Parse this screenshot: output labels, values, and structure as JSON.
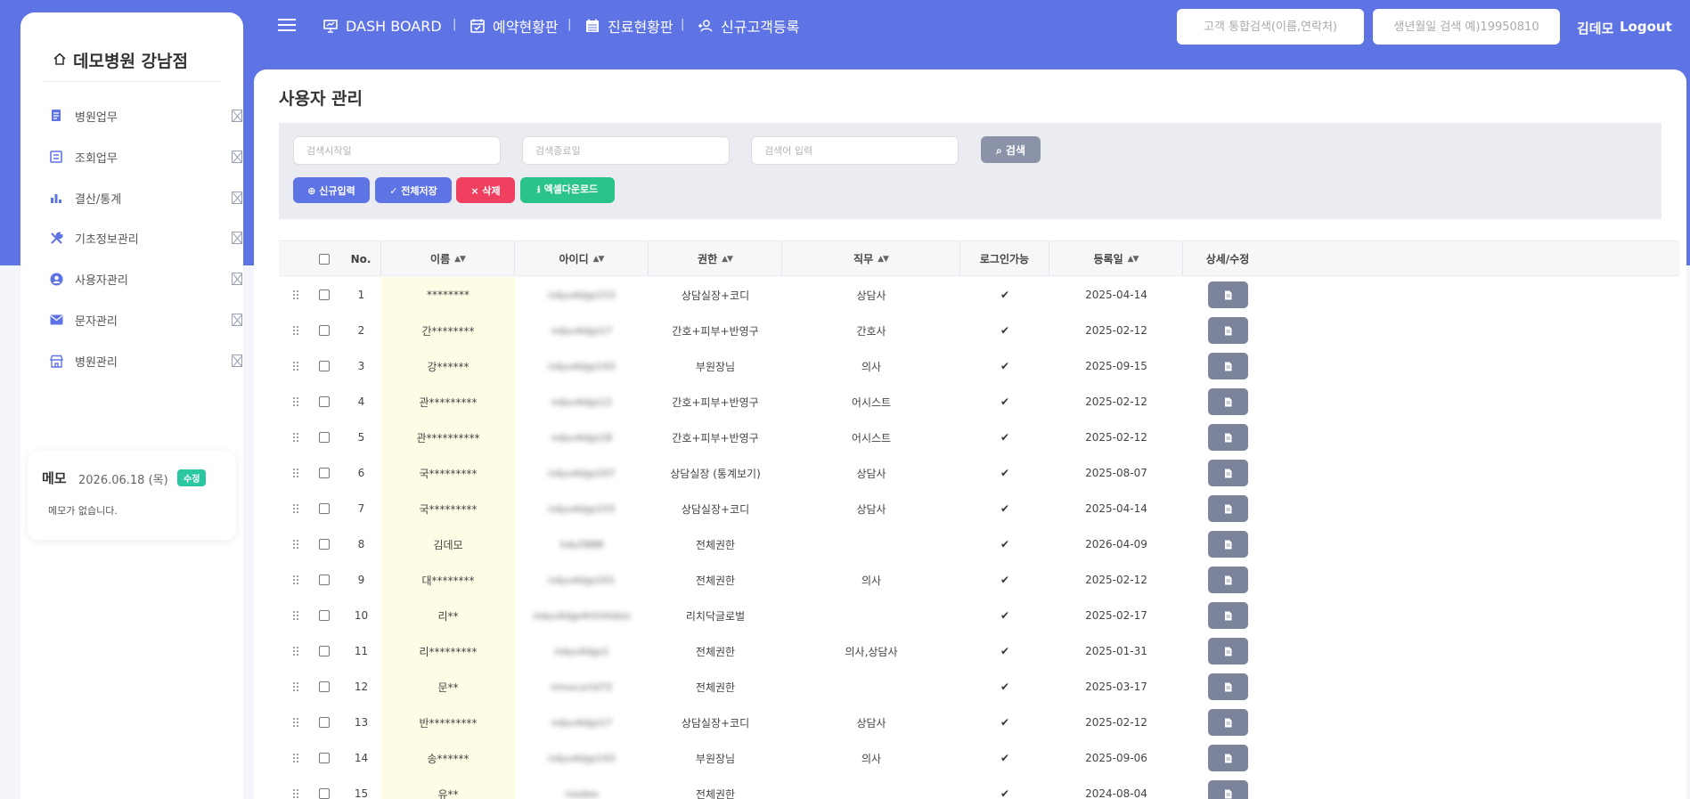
{
  "sidebar": {
    "brand": "데모병원 강남점",
    "items": [
      {
        "label": "병원업무",
        "icon": "document-icon"
      },
      {
        "label": "조회업무",
        "icon": "list-icon"
      },
      {
        "label": "결산/통계",
        "icon": "bar-chart-icon"
      },
      {
        "label": "기초정보관리",
        "icon": "tools-icon"
      },
      {
        "label": "사용자관리",
        "icon": "user-circle-icon"
      },
      {
        "label": "문자관리",
        "icon": "envelope-icon"
      },
      {
        "label": "병원관리",
        "icon": "store-icon"
      }
    ],
    "memo": {
      "title": "메모",
      "date": "2026.06.18 (목)",
      "edit_label": "수정",
      "body": "메모가 없습니다."
    }
  },
  "header": {
    "nav": [
      {
        "label": "DASH BOARD",
        "icon": "presentation-icon"
      },
      {
        "label": "예약현황판",
        "icon": "calendar-check-icon"
      },
      {
        "label": "진료현황판",
        "icon": "calendar-icon"
      },
      {
        "label": "신규고객등록",
        "icon": "user-plus-icon"
      }
    ],
    "search_customer_placeholder": "고객 통합검색(이름,연락처)",
    "search_birth_placeholder": "생년월일 검색 예)19950810",
    "user_name": "김데모",
    "logout_label": "Logout"
  },
  "main": {
    "title": "사용자 관리",
    "filters": {
      "start_placeholder": "검색시작일",
      "end_placeholder": "검색종료일",
      "keyword_placeholder": "검색어 입력",
      "search_label": "검색"
    },
    "actions": {
      "new_label": "신규입력",
      "save_all_label": "전체저장",
      "delete_label": "삭제",
      "excel_label": "엑셀다운로드"
    },
    "colors": {
      "header_bg": "#5f74e4",
      "new_btn": "#5f74e4",
      "delete_btn": "#f0405f",
      "excel_btn": "#2ac48a",
      "name_col_bg": "#fffce6"
    },
    "table": {
      "headers": {
        "no": "No.",
        "name": "이름",
        "id": "아이디",
        "role": "권한",
        "job": "직무",
        "login": "로그인가능",
        "reg_date": "등록일",
        "detail": "상세/수정"
      },
      "rows": [
        {
          "no": "1",
          "name": "********",
          "id": "ndyu4dgs153",
          "role": "상담실장+코디",
          "job": "상담사",
          "login": "✔",
          "date": "2025-04-14"
        },
        {
          "no": "2",
          "name": "간********",
          "id": "ndyu4dgs17",
          "role": "간호+피부+반영구",
          "job": "간호사",
          "login": "✔",
          "date": "2025-02-12"
        },
        {
          "no": "3",
          "name": "강******",
          "id": "ndyu4dgs143",
          "role": "부원장님",
          "job": "의사",
          "login": "✔",
          "date": "2025-09-15"
        },
        {
          "no": "4",
          "name": "관*********",
          "id": "ndyu4dgs12",
          "role": "간호+피부+반영구",
          "job": "어시스트",
          "login": "✔",
          "date": "2025-02-12"
        },
        {
          "no": "5",
          "name": "관**********",
          "id": "ndyu4dgs18",
          "role": "간호+피부+반영구",
          "job": "어시스트",
          "login": "✔",
          "date": "2025-02-12"
        },
        {
          "no": "6",
          "name": "국*********",
          "id": "ndyu4dgs107",
          "role": "상담실장 (통계보기)",
          "job": "상담사",
          "login": "✔",
          "date": "2025-08-07"
        },
        {
          "no": "7",
          "name": "국*********",
          "id": "ndyu4dgs155",
          "role": "상담실장+코디",
          "job": "상담사",
          "login": "✔",
          "date": "2025-04-14"
        },
        {
          "no": "8",
          "name": "김데모",
          "id": "hdu5888",
          "role": "전체권한",
          "job": "",
          "login": "✔",
          "date": "2026-04-09"
        },
        {
          "no": "9",
          "name": "대********",
          "id": "ndyu4dgs101",
          "role": "전체권한",
          "job": "의사",
          "login": "✔",
          "date": "2025-02-12"
        },
        {
          "no": "10",
          "name": "리**",
          "id": "ndyu4dgs4rtnhtdoo",
          "role": "리치닥글로벌",
          "job": "",
          "login": "✔",
          "date": "2025-02-17"
        },
        {
          "no": "11",
          "name": "리*********",
          "id": "ndyu4dgs1",
          "role": "전체권한",
          "job": "의사,상담사",
          "login": "✔",
          "date": "2025-01-31"
        },
        {
          "no": "12",
          "name": "문**",
          "id": "nmucuctd72",
          "role": "전체권한",
          "job": "",
          "login": "✔",
          "date": "2025-03-17"
        },
        {
          "no": "13",
          "name": "반*********",
          "id": "ndyu4dgs17",
          "role": "상담실장+코디",
          "job": "상담사",
          "login": "✔",
          "date": "2025-02-12"
        },
        {
          "no": "14",
          "name": "송******",
          "id": "ndyu4dgs143",
          "role": "부원장님",
          "job": "의사",
          "login": "✔",
          "date": "2025-09-06"
        },
        {
          "no": "15",
          "name": "유**",
          "id": "rsodeo",
          "role": "전체권한",
          "job": "",
          "login": "✔",
          "date": "2024-08-04"
        }
      ]
    }
  }
}
